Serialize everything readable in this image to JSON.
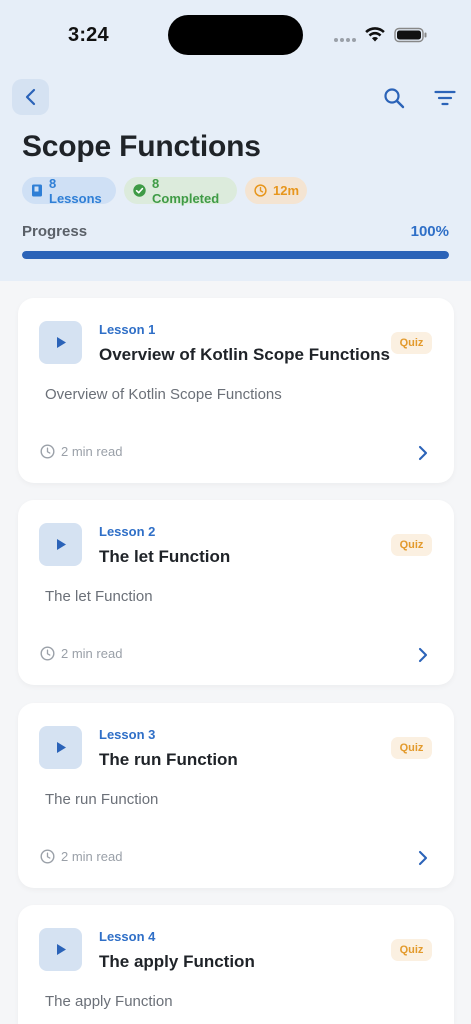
{
  "status": {
    "time": "3:24"
  },
  "header": {
    "title": "Scope Functions",
    "chips": {
      "lessons": "8 Lessons",
      "completed": "8 Completed",
      "time": "12m"
    },
    "progress": {
      "label": "Progress",
      "value_text": "100%",
      "fraction": 1.0
    }
  },
  "lessons": [
    {
      "number": "Lesson 1",
      "title": "Overview of Kotlin Scope Functions",
      "badge": "Quiz",
      "description": "Overview of Kotlin Scope Functions",
      "read_time": "2 min read"
    },
    {
      "number": "Lesson 2",
      "title": "The let Function",
      "badge": "Quiz",
      "description": "The let Function",
      "read_time": "2 min read"
    },
    {
      "number": "Lesson 3",
      "title": "The run Function",
      "badge": "Quiz",
      "description": "The run Function",
      "read_time": "2 min read"
    },
    {
      "number": "Lesson 4",
      "title": "The apply Function",
      "badge": "Quiz",
      "description": "The apply Function",
      "read_time": "2 min read"
    }
  ],
  "colors": {
    "header_bg": "#e6eef8",
    "accent": "#2b63b8",
    "lessons_chip": "#2f7fd6",
    "completed_chip": "#3f9b46",
    "time_chip": "#e7961d",
    "quiz_badge": "#e39a2c"
  },
  "icons": {
    "back": "chevron-left-icon",
    "search": "search-icon",
    "filter": "filter-icon",
    "lessons": "book-icon",
    "completed": "check-circle-icon",
    "time": "clock-icon",
    "play": "play-icon",
    "open": "chevron-right-icon"
  }
}
